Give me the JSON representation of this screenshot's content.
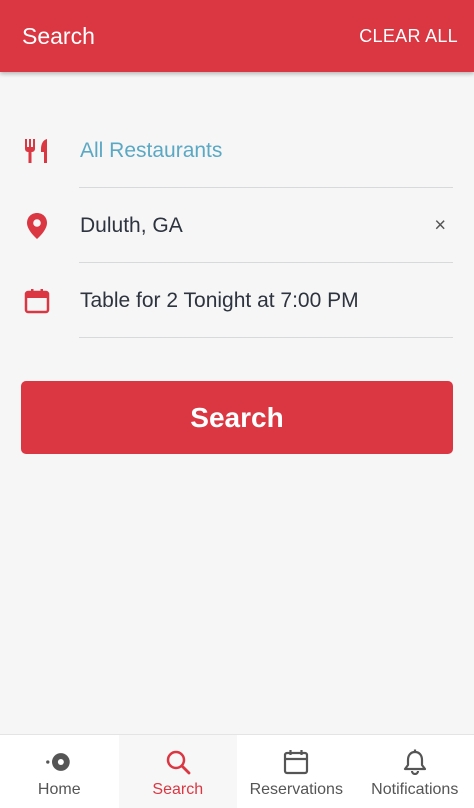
{
  "header": {
    "title": "Search",
    "clear_all": "CLEAR ALL"
  },
  "form": {
    "restaurants": "All Restaurants",
    "location": "Duluth, GA",
    "clear_location": "×",
    "reservation": "Table for 2 Tonight at 7:00 PM"
  },
  "search_button": "Search",
  "nav": {
    "home": "Home",
    "search": "Search",
    "reservations": "Reservations",
    "notifications": "Notifications"
  },
  "colors": {
    "brand": "#da3743",
    "link": "#5ba8c4"
  }
}
